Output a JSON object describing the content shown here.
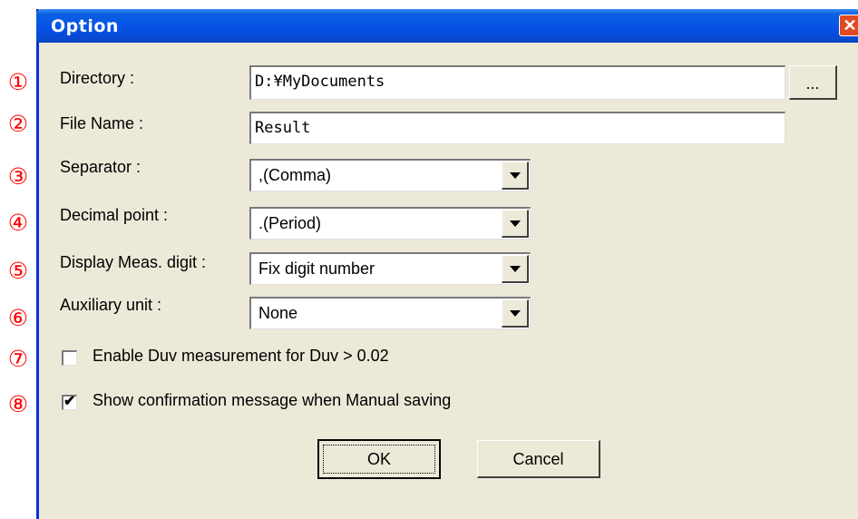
{
  "window": {
    "title": "Option",
    "close_icon": "close-icon"
  },
  "callouts": [
    "①",
    "②",
    "③",
    "④",
    "⑤",
    "⑥",
    "⑦",
    "⑧"
  ],
  "directory": {
    "label": "Directory :",
    "value": "D:¥MyDocuments",
    "browse_label": "..."
  },
  "file_name": {
    "label": "File Name :",
    "value": "Result"
  },
  "separator": {
    "label": "Separator :",
    "selected": ",(Comma)"
  },
  "decimal_point": {
    "label": "Decimal point :",
    "selected": ".(Period)"
  },
  "display_digit": {
    "label": "Display Meas. digit :",
    "selected": "Fix digit number"
  },
  "aux_unit": {
    "label": "Auxiliary unit :",
    "selected": "None"
  },
  "enable_duv": {
    "label": "Enable Duv measurement for Duv > 0.02",
    "checked": false
  },
  "show_confirm": {
    "label": "Show confirmation message when Manual saving",
    "checked": true,
    "check_glyph": "✔"
  },
  "buttons": {
    "ok": "OK",
    "cancel": "Cancel"
  },
  "colors": {
    "titlebar": "#0553e6",
    "dialog_bg": "#ece9d8",
    "callout": "#ff0000",
    "close": "#e04a23"
  }
}
